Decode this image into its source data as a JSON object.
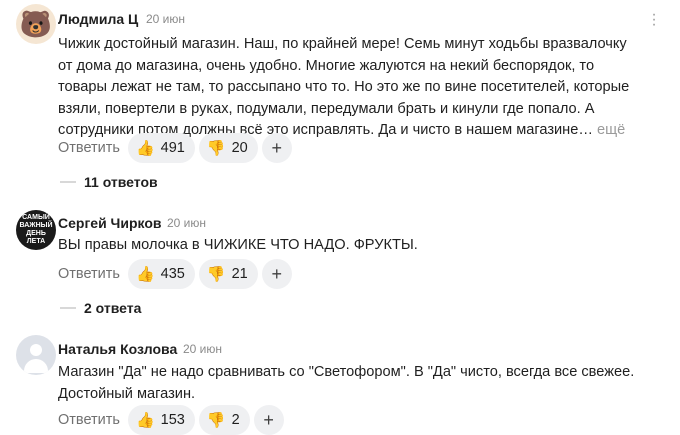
{
  "comments": [
    {
      "author": "Людмила Ц",
      "date": "20 июн",
      "avatar_icon": "bear-emoji-icon",
      "text_lines": [
        "Чижик достойный магазин. Наш, по крайней мере! Семь минут ходьбы вразвалочку",
        "от дома до магазина, очень удобно. Многие жалуются на некий беспорядок, то",
        "товары лежат не там, то рассыпано что то. Но это же по вине посетителей, которые",
        "взяли, повертели в руках, подумали, передумали брать и кинули где попало. А",
        "сотрудники потом должны всё это исправлять. Да и чисто в нашем магазине…"
      ],
      "more_label": "ещё",
      "reply_label": "Ответить",
      "likes": "491",
      "dislikes": "20",
      "replies_label": "11 ответов"
    },
    {
      "author": "Сергей Чирков",
      "date": "20 июн",
      "avatar_text": "САМЫЙ ВАЖНЫЙ ДЕНЬ ЛЕТА",
      "text_lines": [
        "ВЫ правы молочка в ЧИЖИКЕ ЧТО НАДО. ФРУКТЫ."
      ],
      "reply_label": "Ответить",
      "likes": "435",
      "dislikes": "21",
      "replies_label": "2 ответа"
    },
    {
      "author": "Наталья Козлова",
      "date": "20 июн",
      "avatar_icon": "default-user-icon",
      "text_lines": [
        "Магазин \"Да\" не надо сравнивать со \"Светофором\". В \"Да\" чисто, всегда все свежее.",
        "Достойный магазин."
      ],
      "reply_label": "Ответить",
      "likes": "153",
      "dislikes": "2"
    }
  ],
  "colors": {
    "pill_bg": "#eff0f2",
    "muted": "#8a8a8a",
    "accent_thumb": "#f5a623"
  }
}
